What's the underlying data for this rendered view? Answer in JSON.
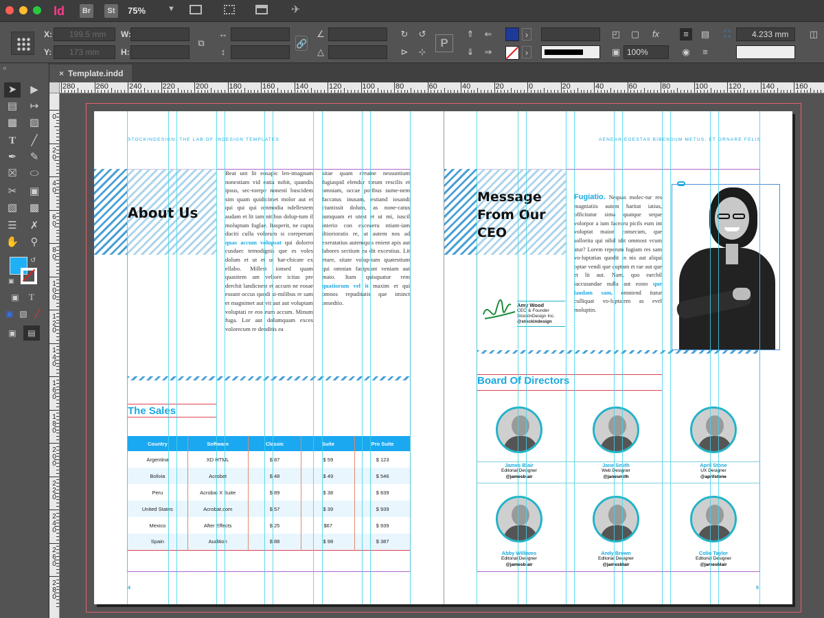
{
  "app": {
    "logo": "Id",
    "bridge": "Br",
    "stock": "St",
    "zoom": "75%"
  },
  "control": {
    "x_label": "X:",
    "y_label": "Y:",
    "w_label": "W:",
    "h_label": "H:",
    "x_value": "199.5 mm",
    "y_value": "173 mm",
    "opacity": "100%",
    "stroke_weight": "4.233 mm"
  },
  "document": {
    "tab_title": "Template.indd",
    "close": "×"
  },
  "rulers": {
    "h_ticks": [
      "280",
      "260",
      "240",
      "220",
      "200",
      "180",
      "160",
      "140",
      "120",
      "100",
      "80",
      "60",
      "40",
      "20",
      "0",
      "20",
      "40",
      "60",
      "80",
      "100",
      "120",
      "140",
      "160"
    ],
    "v_ticks": [
      "0",
      "2 0",
      "4 0",
      "6 0",
      "8 0",
      "1 0 0",
      "1 2 0",
      "1 4 0",
      "1 6 0",
      "1 8 0",
      "2 0 0",
      "2 2 0",
      "2 4 0",
      "2 6 0",
      "2 8 0"
    ]
  },
  "left_page": {
    "running_head": "StockInDesign. The LAB of InDesign Templates",
    "title": "About Us",
    "col1": "Beat unt lit eosapic len-imagnam nonestiam vid eatia nobit, quundis ipsus, sec-torepe nonesti buscidem sim quam quidicimet molor aut et qui qui qui ommodia ndellestem audam et lit iam nitibus dolup-tum il moluptam fuglae. Itasperit, ne cupta duciti culla volorum si coreperum",
    "col1_link": "quas accum volupsat",
    "col1_b": "qui dolorro cusdaec temodignis que es voles dolum et ut et ut har-chicate ex ellabo. Millest ionsed quam quasitem am veliore icitas pre derchit landicnest et accum ne eosae essunt occus quodi si-milibus re sam et magnimet aut vit aut aut voluptam voluptati re eos eum accum. Minum fuga. Lor aut dolumquam exces volorecum re denditis ea",
    "col2": "sitae quam rerume nessuntium fugiaspid elendur torum rescilis et omniam, occae poribus sume-nem faccatus inusam, estiand iosandi ciuntissit dolum, as none-catus iumquam et utest et ut mi, iuscil interio con exceaeru ntiant-iam iltiorioratis re, ut autem nos ad exeratatius autemquis enient apis aut labores sectium ea dit excestius. Lit eture, sitate volup-tam quatestium qui omnian facipsunt veniam aut maio. Itam quisquatur rem",
    "col2_link": "quatiorum vel it",
    "col2_b": "maxim et qui omnos repuditatis que iminct onsedtio.",
    "sales_title": "The Sales",
    "table_headers": [
      "Country",
      "Software",
      "Classic",
      "Suite",
      "Pro Suite"
    ],
    "table_rows": [
      [
        "Argentina",
        "XD HTML",
        "$ 87",
        "$ 59",
        "$ 123"
      ],
      [
        "Bolivia",
        "Acrobat",
        "$ 48",
        "$ 49",
        "$ 546"
      ],
      [
        "Peru",
        "Acrobat X Suite",
        "$ 89",
        "$ 38",
        "$ 839"
      ],
      [
        "United States",
        "Acrobat.com",
        "$ 57",
        "$ 39",
        "$ 939"
      ],
      [
        "Mexico",
        "After Effects",
        "$ 25",
        "$67",
        "$ 939"
      ],
      [
        "Spain",
        "Audition",
        "$ 88",
        "$ 98",
        "$ 387"
      ]
    ],
    "folio": "4"
  },
  "right_page": {
    "running_head": "Aenean egestas bibendum metus, et ornare felis",
    "title_l1": "Message",
    "title_l2": "From Our",
    "title_l3": "CEO",
    "lead": "Fugiatio.",
    "ceo_text": "Nequas molec-tur res magniatiis autem haritat iatius, officitatur sima quatque seque volorpor a ium facearu picils eum int voluptat maion consecum, que sollorita qui nihil idit ommost vcum atur? Lorem reperum fugiam res sam vo-luptatias quodit in nis aut aliqui optae vendi que cuptam et rae aut que et lit aut. Nam, quo earchil iaccusandae nulla aut eosto",
    "ceo_link": "que laudam sam,",
    "ceo_text_b": "omniend itatur culliquat vo-luptatem as evel moluptin.",
    "ceo_name": "Amy Wood",
    "ceo_role1": "CEO & Founder",
    "ceo_role2": "StockInDesign Inc.",
    "ceo_handle": "@stockindesign",
    "board_title": "Board Of Directors",
    "directors": [
      {
        "name": "James Blair",
        "role": "Editorial Designer",
        "handle": "@jamesblair"
      },
      {
        "name": "Jane Smith",
        "role": "Web Designer",
        "handle": "@janesmith"
      },
      {
        "name": "April Stone",
        "role": "UX Designer",
        "handle": "@aprilstone"
      },
      {
        "name": "Abby Williams",
        "role": "Editorial Designer",
        "handle": "@jamesblair"
      },
      {
        "name": "Andy Brown",
        "role": "Editorial Designer",
        "handle": "@jamesblair"
      },
      {
        "name": "Colin Taylor",
        "role": "Editorial Designer",
        "handle": "@jamesblair"
      }
    ],
    "folio": "5"
  },
  "colors": {
    "accent": "#1aa8e0",
    "guide": "#3fd4e6",
    "margin": "#b062c8",
    "bleed": "#e8606f"
  }
}
